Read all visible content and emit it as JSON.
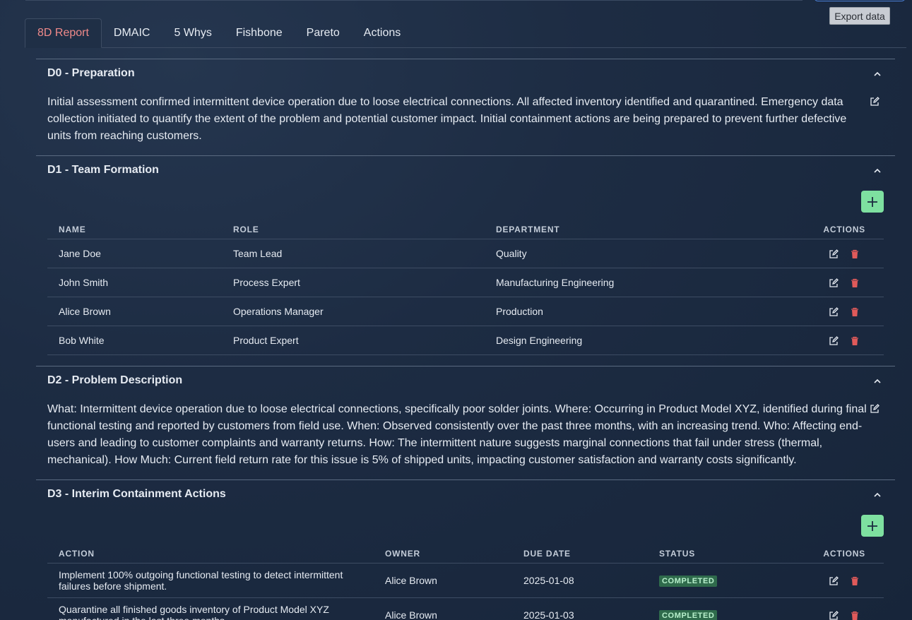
{
  "toolbar": {
    "export_label": "Export data"
  },
  "tabs": [
    "8D Report",
    "DMAIC",
    "5 Whys",
    "Fishbone",
    "Pareto",
    "Actions"
  ],
  "d0": {
    "title": "D0 - Preparation",
    "text": "Initial assessment confirmed intermittent device operation due to loose electrical connections. All affected inventory identified and quarantined. Emergency data collection initiated to quantify the extent of the problem and potential customer impact. Initial containment actions are being prepared to prevent further defective units from reaching customers."
  },
  "d1": {
    "title": "D1 - Team Formation",
    "columns": [
      "NAME",
      "ROLE",
      "DEPARTMENT",
      "ACTIONS"
    ],
    "rows": [
      {
        "name": "Jane Doe",
        "role": "Team Lead",
        "department": "Quality"
      },
      {
        "name": "John Smith",
        "role": "Process Expert",
        "department": "Manufacturing Engineering"
      },
      {
        "name": "Alice Brown",
        "role": "Operations Manager",
        "department": "Production"
      },
      {
        "name": "Bob White",
        "role": "Product Expert",
        "department": "Design Engineering"
      }
    ]
  },
  "d2": {
    "title": "D2 - Problem Description",
    "text": "What: Intermittent device operation due to loose electrical connections, specifically poor solder joints. Where: Occurring in Product Model XYZ, identified during final functional testing and reported by customers from field use. When: Observed consistently over the past three months, with an increasing trend. Who: Affecting end-users and leading to customer complaints and warranty returns. How: The intermittent nature suggests marginal connections that fail under stress (thermal, mechanical). How Much: Current field return rate for this issue is 5% of shipped units, impacting customer satisfaction and warranty costs significantly."
  },
  "d3": {
    "title": "D3 - Interim Containment Actions",
    "columns": [
      "ACTION",
      "OWNER",
      "DUE DATE",
      "STATUS",
      "ACTIONS"
    ],
    "rows": [
      {
        "action": "Implement 100% outgoing functional testing to detect intermittent failures before shipment.",
        "owner": "Alice Brown",
        "due": "2025-01-08",
        "status": "COMPLETED"
      },
      {
        "action": "Quarantine all finished goods inventory of Product Model XYZ manufactured in the last three months.",
        "owner": "Alice Brown",
        "due": "2025-01-03",
        "status": "COMPLETED"
      }
    ]
  },
  "colors": {
    "accent_tab": "#f08a8a",
    "add_button": "#7ee0a0",
    "delete_icon": "#e05a5a",
    "status_completed": "#2f6b4c"
  }
}
